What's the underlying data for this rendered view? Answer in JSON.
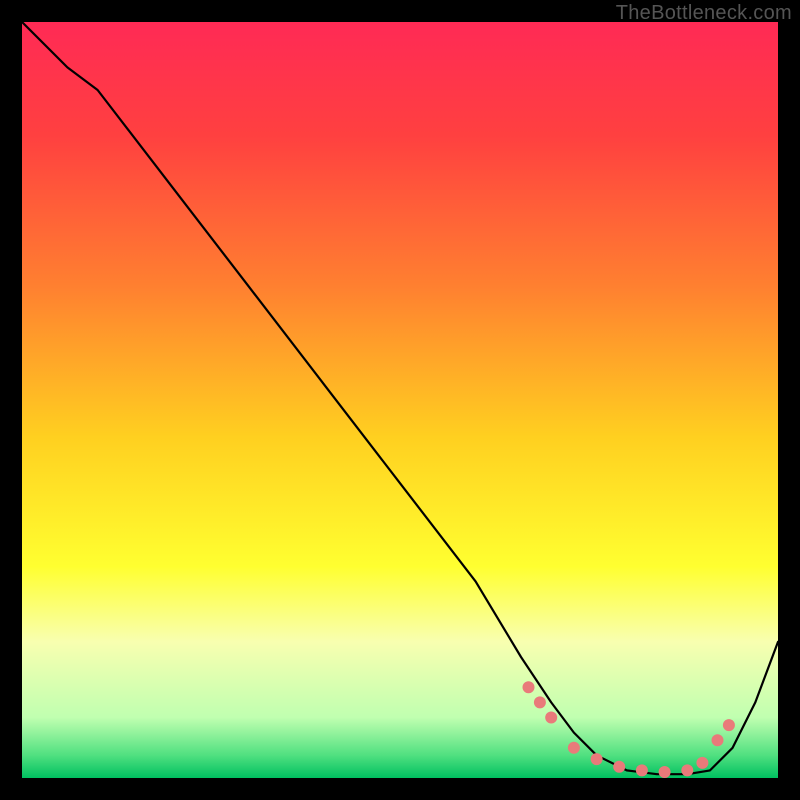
{
  "watermark": "TheBottleneck.com",
  "chart_data": {
    "type": "line",
    "title": "",
    "xlabel": "",
    "ylabel": "",
    "xlim": [
      0,
      100
    ],
    "ylim": [
      0,
      100
    ],
    "gradient_stops": [
      {
        "offset": 0.0,
        "color": "#ff2a55"
      },
      {
        "offset": 0.15,
        "color": "#ff4040"
      },
      {
        "offset": 0.35,
        "color": "#ff8030"
      },
      {
        "offset": 0.55,
        "color": "#ffd020"
      },
      {
        "offset": 0.72,
        "color": "#ffff30"
      },
      {
        "offset": 0.82,
        "color": "#f8ffb0"
      },
      {
        "offset": 0.92,
        "color": "#c0ffb0"
      },
      {
        "offset": 0.97,
        "color": "#50e080"
      },
      {
        "offset": 1.0,
        "color": "#00c060"
      }
    ],
    "series": [
      {
        "name": "curve",
        "x": [
          0,
          6,
          10,
          20,
          30,
          40,
          50,
          60,
          66,
          70,
          73,
          76,
          80,
          84,
          88,
          91,
          94,
          97,
          100
        ],
        "y": [
          100,
          94,
          91,
          78,
          65,
          52,
          39,
          26,
          16,
          10,
          6,
          3,
          1,
          0.5,
          0.5,
          1,
          4,
          10,
          18
        ]
      }
    ],
    "markers": {
      "name": "dots",
      "color": "#e97a7a",
      "radius": 6,
      "x": [
        67,
        68.5,
        70,
        73,
        76,
        79,
        82,
        85,
        88,
        90,
        92,
        93.5
      ],
      "y": [
        12,
        10,
        8,
        4,
        2.5,
        1.5,
        1,
        0.8,
        1,
        2,
        5,
        7
      ]
    }
  }
}
